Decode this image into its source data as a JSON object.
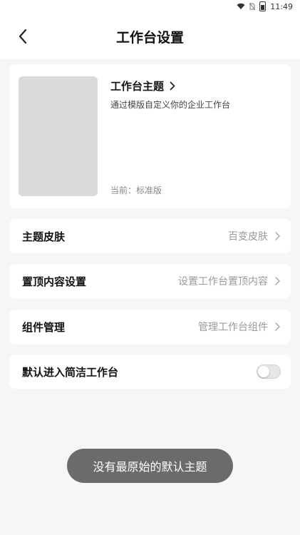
{
  "status_bar": {
    "time": "11:49",
    "icons": [
      "wifi-icon",
      "no-sim-icon",
      "battery-icon"
    ]
  },
  "header": {
    "title": "工作台设置",
    "back_icon": "chevron-left-icon"
  },
  "theme_card": {
    "title": "工作台主题",
    "title_icon": "chevron-right-icon",
    "description": "通过模版自定义你的企业工作台",
    "current": "当前：标准版"
  },
  "settings": [
    {
      "label": "主题皮肤",
      "value": "百变皮肤"
    },
    {
      "label": "置顶内容设置",
      "value": "设置工作台置顶内容"
    },
    {
      "label": "组件管理",
      "value": "管理工作台组件"
    }
  ],
  "simple_mode": {
    "label": "默认进入简洁工作台",
    "enabled": false
  },
  "toast": {
    "message": "没有最原始的默认主题"
  },
  "colors": {
    "background": "#f6f6f7",
    "card": "#ffffff",
    "thumbnail": "#d9d9d9",
    "toast": "#6b6b6b",
    "muted_text": "#9a9a9a"
  }
}
